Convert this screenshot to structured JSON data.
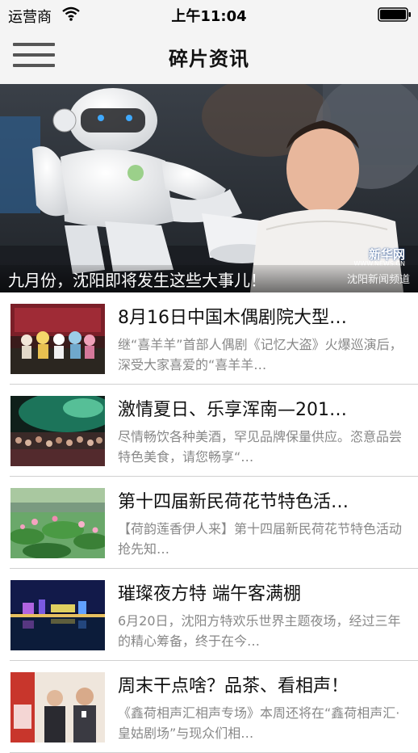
{
  "status_bar": {
    "carrier": "运营商",
    "time": "上午11:04"
  },
  "nav": {
    "title": "碎片资讯"
  },
  "banner": {
    "caption": "九月份，沈阳即将发生这些大事儿！",
    "watermark_brand": "新华网",
    "watermark_url": "WWW.NEWS.CN",
    "watermark_channel": "沈阳新闻频道"
  },
  "news": [
    {
      "title": "8月16日中国木偶剧院大型…",
      "summary": "继“喜羊羊”首部人偶剧《记忆大盗》火爆巡演后，深受大家喜爱的“喜羊羊…",
      "thumb": "puppet-show"
    },
    {
      "title": "激情夏日、乐享浑南—201…",
      "summary": "尽情畅饮各种美酒，罕见品牌保量供应。恣意品尝特色美食，请您畅享“…",
      "thumb": "concert-crowd"
    },
    {
      "title": "第十四届新民荷花节特色活…",
      "summary": "【荷韵莲香伊人来】第十四届新民荷花节特色活动抢先知…",
      "thumb": "lotus-pond"
    },
    {
      "title": "璀璨夜方特 端午客满棚",
      "summary": "6月20日，沈阳方特欢乐世界主题夜场，经过三年的精心筹备，终于在今…",
      "thumb": "night-park"
    },
    {
      "title": "周末干点啥？品茶、看相声！",
      "summary": "《鑫荷相声汇相声专场》本周还将在“鑫荷相声汇·皇姑剧场”与现众们相…",
      "thumb": "crosstalk"
    }
  ]
}
